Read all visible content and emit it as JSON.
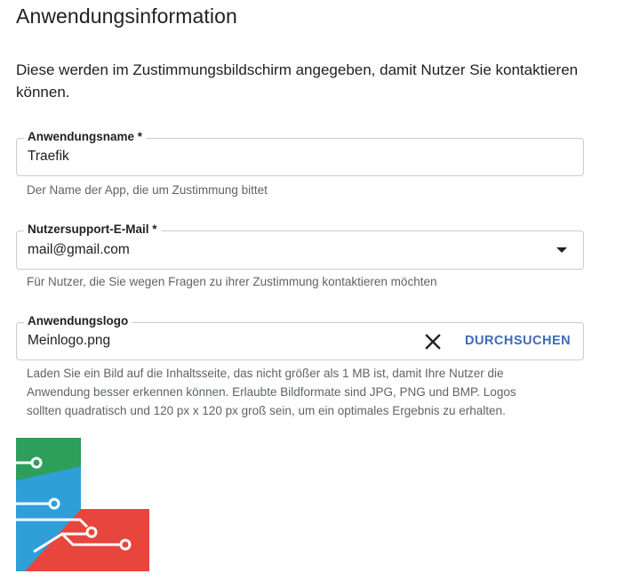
{
  "heading": "Anwendungsinformation",
  "description": "Diese werden im Zustimmungsbildschirm angegeben, damit Nutzer Sie kontaktieren können.",
  "app_name": {
    "label": "Anwendungsname *",
    "value": "Traefik",
    "hint": "Der Name der App, die um Zustimmung bittet"
  },
  "support_email": {
    "label": "Nutzersupport-E-Mail *",
    "value": "mail@gmail.com",
    "hint": "Für Nutzer, die Sie wegen Fragen zu ihrer Zustimmung kontaktieren möchten"
  },
  "app_logo": {
    "label": "Anwendungslogo",
    "value": "Meinlogo.png",
    "browse_label": "DURCHSUCHEN",
    "hint_lines": [
      "Laden Sie ein Bild auf die Inhaltsseite, das nicht größer als 1 MB ist, damit Ihre Nutzer die",
      "Anwendung besser erkennen können. Erlaubte Bildformate sind JPG, PNG und BMP. Logos",
      "sollten quadratisch und 120 px x 120 px groß sein, um ein optimales Ergebnis zu erhalten."
    ]
  },
  "colors": {
    "link_blue": "#3f6bb5",
    "logo_green": "#2e9e5b",
    "logo_blue": "#2f9fd8",
    "logo_red": "#e8453c"
  },
  "icons": {
    "dropdown": "arrow-drop-down-icon",
    "clear": "close-icon",
    "logo_image": "logo-preview"
  }
}
